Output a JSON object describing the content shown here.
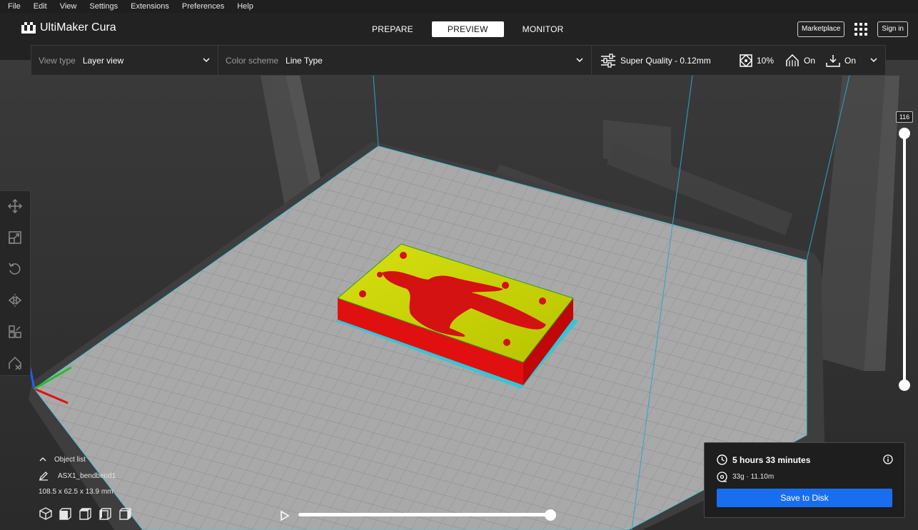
{
  "app": {
    "name": "UltiMaker Cura"
  },
  "menu": [
    "File",
    "Edit",
    "View",
    "Settings",
    "Extensions",
    "Preferences",
    "Help"
  ],
  "header": {
    "stages": [
      "PREPARE",
      "PREVIEW",
      "MONITOR"
    ],
    "active_stage": "PREVIEW",
    "marketplace_label": "Marketplace",
    "signin_label": "Sign in"
  },
  "viewbar": {
    "view_type_label": "View type",
    "view_type_value": "Layer view",
    "color_scheme_label": "Color scheme",
    "color_scheme_value": "Line Type",
    "profile": "Super Quality - 0.12mm",
    "infill": "10%",
    "support": "On",
    "adhesion": "On"
  },
  "layer_slider": {
    "current_layer": "116"
  },
  "object_list": {
    "title": "Object list",
    "object_name": "ASX1_bendbend1",
    "dimensions": "108.5 x 62.5 x 13.9 mm"
  },
  "playback": {
    "progress": 1.0
  },
  "print_info": {
    "time": "5 hours 33 minutes",
    "material": "33g · 11.10m",
    "save_label": "Save to Disk"
  },
  "colors": {
    "accent": "#196ef0",
    "build_plate": "#a8a8a8",
    "model_wall": "#e01010",
    "model_top": "#c8d400",
    "skirt": "#30c8d8"
  }
}
